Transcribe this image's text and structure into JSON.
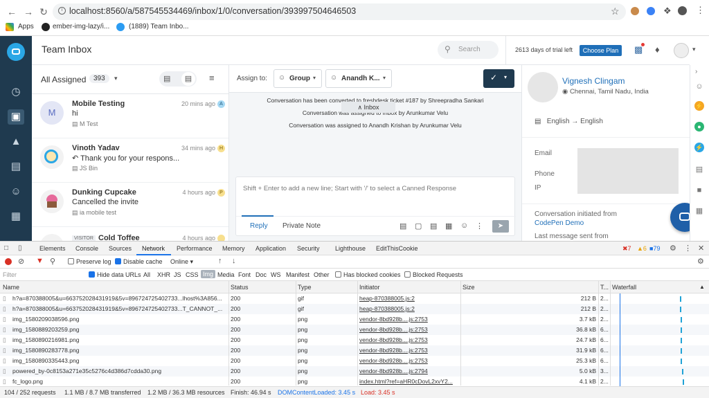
{
  "browser": {
    "url": "localhost:8560/a/587545534469/inbox/1/0/conversation/393997504646503",
    "bookmarks": [
      "Apps",
      "ember-img-lazy/i...",
      "(1889) Team Inbo..."
    ]
  },
  "app": {
    "title": "Team Inbox",
    "search_placeholder": "Search",
    "trial_text": "2613 days of trial left",
    "choose_plan": "Choose Plan",
    "nav_icons": [
      "dashboard-icon",
      "inbox-icon",
      "campaigns-icon",
      "knowledge-base-icon",
      "contacts-icon",
      "reports-icon"
    ]
  },
  "list": {
    "filter_label": "All Assigned",
    "count": "393",
    "conversations": [
      {
        "name": "Mobile Testing",
        "message": "hi",
        "sub": "M Test",
        "time": "20 mins ago",
        "badge": "A",
        "avatar": "M",
        "avatar_color": "#e3e6f5",
        "badge_color": "#a5d8f3"
      },
      {
        "name": "Vinoth Yadav",
        "message": "Thank you for your respons...",
        "sub": "JS Bin",
        "time": "34 mins ago",
        "badge": "H",
        "avatar": "",
        "avatar_color": "#f2f2f2",
        "badge_color": "#f7df8e"
      },
      {
        "name": "Dunking Cupcake",
        "message": "Cancelled the invite",
        "sub": "ia mobile test",
        "time": "4 hours ago",
        "badge": "P",
        "avatar": "",
        "avatar_color": "#f2f2f2",
        "badge_color": "#f7df8e"
      },
      {
        "name": "Cold Toffee",
        "message": "",
        "sub": "",
        "time": "4 hours ago",
        "badge": "",
        "avatar": "",
        "avatar_color": "#f2f2f2",
        "badge_color": "#f7df8e",
        "tag": "VISITOR"
      }
    ]
  },
  "conversation": {
    "assign_to": "Assign to:",
    "group_label": "Group",
    "agent_label": "Anandh K...",
    "tooltip": "Inbox",
    "system_messages": [
      "Conversation has been converted to freshdesk ticket #187 by Shreepradha Sankari",
      "Conversation was assigned to Inbox by Arunkumar Velu",
      "Conversation was assigned to Anandh Krishan by Arunkumar Velu"
    ],
    "composer_placeholder": "Shift + Enter to add a new line; Start with '/' to select a Canned Response",
    "reply_tab": "Reply",
    "private_tab": "Private Note"
  },
  "profile": {
    "name": "Vignesh Clingam",
    "location": "Chennai, Tamil Nadu, India",
    "language": "English → English",
    "fields": [
      "Email",
      "Phone",
      "IP"
    ],
    "initiated_label": "Conversation initiated from",
    "initiated_value": "CodePen Demo",
    "last_message_label": "Last message sent from"
  },
  "devtools": {
    "tabs": [
      "Elements",
      "Console",
      "Sources",
      "Network",
      "Performance",
      "Memory",
      "Application",
      "Security",
      "Lighthouse",
      "EditThisCookie"
    ],
    "active_tab": "Network",
    "errors": "7",
    "warnings": "6",
    "messages": "79",
    "preserve_log": "Preserve log",
    "disable_cache": "Disable cache",
    "throttle": "Online",
    "filter_placeholder": "Filter",
    "hide_data_urls": "Hide data URLs",
    "type_filters": [
      "All",
      "XHR",
      "JS",
      "CSS",
      "Img",
      "Media",
      "Font",
      "Doc",
      "WS",
      "Manifest",
      "Other"
    ],
    "active_type": "Img",
    "has_blocked": "Has blocked cookies",
    "blocked_requests": "Blocked Requests",
    "columns": [
      "Name",
      "Status",
      "Type",
      "Initiator",
      "Size",
      "T...",
      "Waterfall"
    ],
    "rows": [
      {
        "name": "h?a=870388005&u=663752028431919&5v=896724725402733...lhost%3A856...",
        "status": "200",
        "type": "gif",
        "initiator": "heap-870388005.js:2",
        "size": "212 B",
        "time": "2...",
        "wf": 0.72
      },
      {
        "name": "h?a=870388005&u=663752028431919&5v=896724725402733...T_CANNOT_...",
        "status": "200",
        "type": "gif",
        "initiator": "heap-870388005.js:2",
        "size": "212 B",
        "time": "2...",
        "wf": 0.72
      },
      {
        "name": "img_1580209038596.png",
        "status": "200",
        "type": "png",
        "initiator": "vendor-8bd928b....js:2753",
        "size": "3.7 kB",
        "time": "2...",
        "wf": 0.73
      },
      {
        "name": "img_1580889203259.png",
        "status": "200",
        "type": "png",
        "initiator": "vendor-8bd928b....js:2753",
        "size": "36.8 kB",
        "time": "6...",
        "wf": 0.73
      },
      {
        "name": "img_1580890216981.png",
        "status": "200",
        "type": "png",
        "initiator": "vendor-8bd928b....js:2753",
        "size": "24.7 kB",
        "time": "6...",
        "wf": 0.73
      },
      {
        "name": "img_1580890283778.png",
        "status": "200",
        "type": "png",
        "initiator": "vendor-8bd928b....js:2753",
        "size": "31.9 kB",
        "time": "6...",
        "wf": 0.73
      },
      {
        "name": "img_1580890335443.png",
        "status": "200",
        "type": "png",
        "initiator": "vendor-8bd928b....js:2753",
        "size": "25.3 kB",
        "time": "6...",
        "wf": 0.73
      },
      {
        "name": "powered_by-0c8153a271e35c5276c4d386d7cdda30.png",
        "status": "200",
        "type": "png",
        "initiator": "vendor-8bd928b....js:2794",
        "size": "5.0 kB",
        "time": "3...",
        "wf": 0.74
      },
      {
        "name": "fc_logo.png",
        "status": "200",
        "type": "png",
        "initiator": "index.html?ref=aHR0cDovL2xvY2...",
        "size": "4.1 kB",
        "time": "2...",
        "wf": 0.75
      }
    ],
    "status_bar": {
      "requests": "104 / 252 requests",
      "transferred": "1.1 MB / 8.7 MB transferred",
      "resources": "1.2 MB / 36.3 MB resources",
      "finish": "Finish: 46.94 s",
      "dcl": "DOMContentLoaded: 3.45 s",
      "load": "Load: 3.45 s"
    }
  }
}
